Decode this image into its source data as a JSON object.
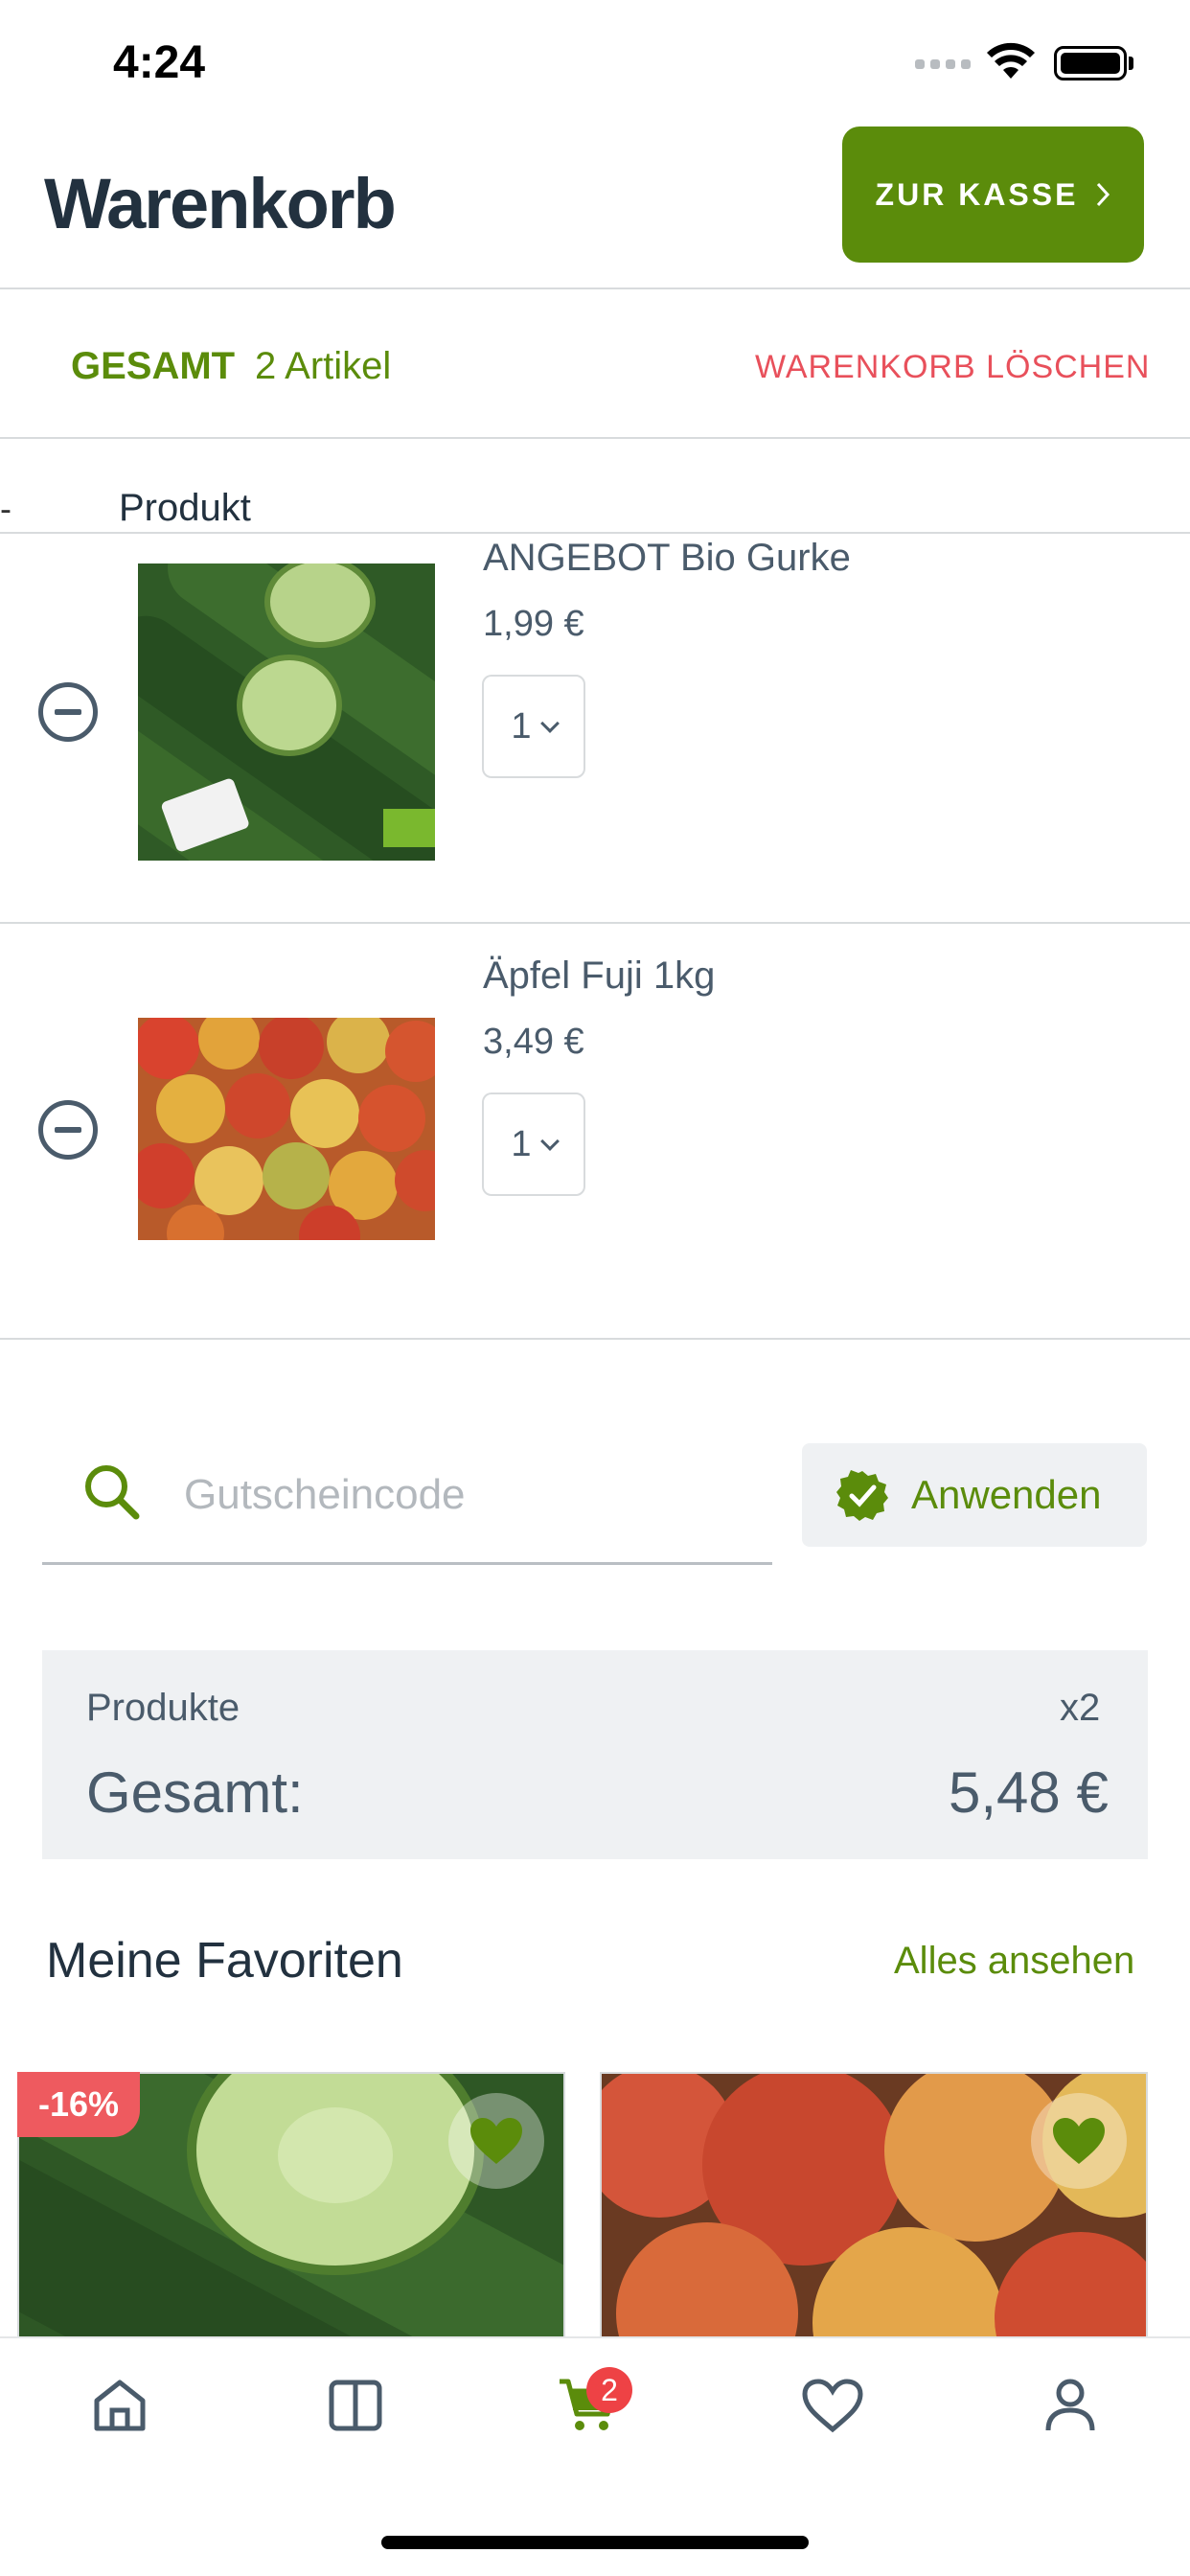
{
  "status_bar": {
    "time": "4:24"
  },
  "header": {
    "title": "Warenkorb",
    "checkout_label": "ZUR KASSE"
  },
  "cart_summary": {
    "gesamt_label": "GESAMT",
    "artikel_count": "2 Artikel",
    "clear_label": "WARENKORB LÖSCHEN"
  },
  "columns": {
    "dash": "-",
    "product": "Produkt"
  },
  "items": [
    {
      "name": "ANGEBOT Bio Gurke",
      "price": "1,99 €",
      "quantity": "1"
    },
    {
      "name": "Äpfel Fuji 1kg",
      "price": "3,49 €",
      "quantity": "1"
    }
  ],
  "coupon": {
    "placeholder": "Gutscheincode",
    "apply_label": "Anwenden"
  },
  "summary": {
    "produkte_label": "Produkte",
    "produkte_count": "x2",
    "gesamt_label": "Gesamt:",
    "total": "5,48 €"
  },
  "favorites": {
    "title": "Meine Favoriten",
    "see_all": "Alles ansehen",
    "cards": [
      {
        "discount": "-16%"
      },
      {
        "discount": ""
      }
    ]
  },
  "tabbar": {
    "cart_badge": "2",
    "tabs": [
      "home-icon",
      "catalog-icon",
      "cart-icon",
      "heart-icon",
      "user-icon"
    ]
  },
  "colors": {
    "accent": "#5b8c0b",
    "danger": "#e8505b",
    "text": "#4a5b6b"
  }
}
